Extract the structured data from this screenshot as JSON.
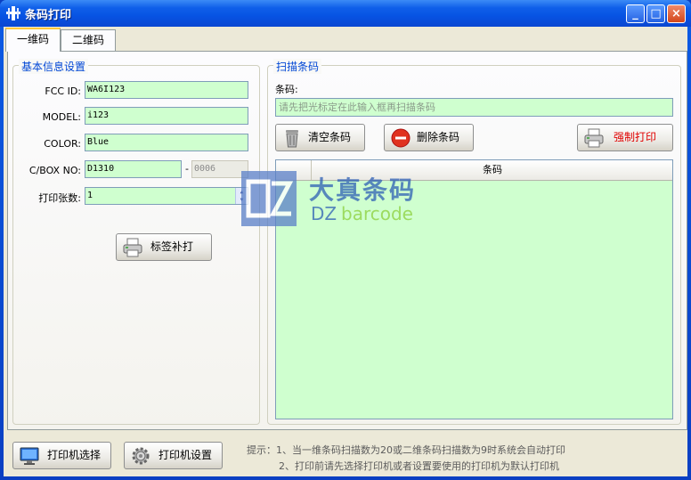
{
  "window": {
    "title": "条码打印",
    "minimize": "_",
    "maximize": "□",
    "close": "×"
  },
  "tabs": [
    {
      "label": "一维码"
    },
    {
      "label": "二维码"
    }
  ],
  "basic": {
    "title": "基本信息设置",
    "fcc_label": "FCC ID:",
    "fcc_value": "WA6I123",
    "model_label": "MODEL:",
    "model_value": "i123",
    "color_label": "COLOR:",
    "color_value": "Blue",
    "cbox_label": "C/BOX NO:",
    "cbox_value": "D1310",
    "cbox_dash": "-",
    "cbox_suffix": "0006",
    "count_label": "打印张数:",
    "count_value": "1",
    "reprint_button": "标签补打"
  },
  "scan": {
    "title": "扫描条码",
    "barcode_label": "条码:",
    "placeholder": "请先把光标定在此输入框再扫描条码",
    "clear_button": "清空条码",
    "delete_button": "删除条码",
    "force_print_button": "强制打印",
    "column_header": "条码"
  },
  "watermark": {
    "cn": "大真条码",
    "en_prefix": "DZ",
    "en_suffix": "barcode"
  },
  "footer": {
    "select_printer_button": "打印机选择",
    "printer_settings_button": "打印机设置",
    "hint_line1": "提示：1、当一维条码扫描数为20或二维条码扫描数为9时系统会自动打印",
    "hint_line2": "2、打印前请先选择打印机或者设置要使用的打印机为默认打印机"
  },
  "colors": {
    "input_bg": "#cfffcf",
    "group_title": "#0046d5",
    "force_print_text": "#e00000"
  }
}
